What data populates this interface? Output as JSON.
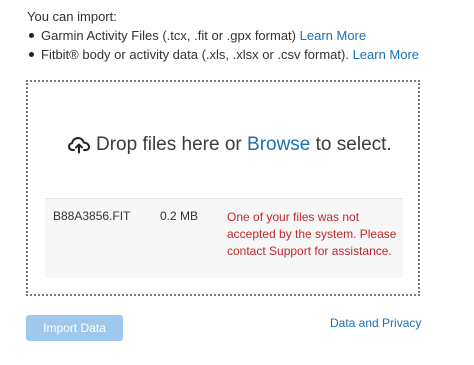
{
  "intro": {
    "text": "You can import:"
  },
  "import_options": [
    {
      "text": "Garmin Activity Files (.tcx, .fit or .gpx format)",
      "link": "Learn More"
    },
    {
      "text": "Fitbit® body or activity data (.xls, .xlsx or .csv format).",
      "link": "Learn More"
    }
  ],
  "dropzone": {
    "icon": "cloud-upload-icon",
    "prompt_before": "Drop files here or",
    "browse_label": "Browse",
    "prompt_after": "to select."
  },
  "files": [
    {
      "name": "B88A3856.FIT",
      "size": "0.2 MB",
      "error": "One of your files was not accepted by the system. Please contact Support for assistance.",
      "error_color": "#c0272d"
    }
  ],
  "actions": {
    "import_label": "Import Data",
    "import_color": "#9ec8ec",
    "privacy_label": "Data and Privacy",
    "link_color": "#1a6fb4"
  }
}
